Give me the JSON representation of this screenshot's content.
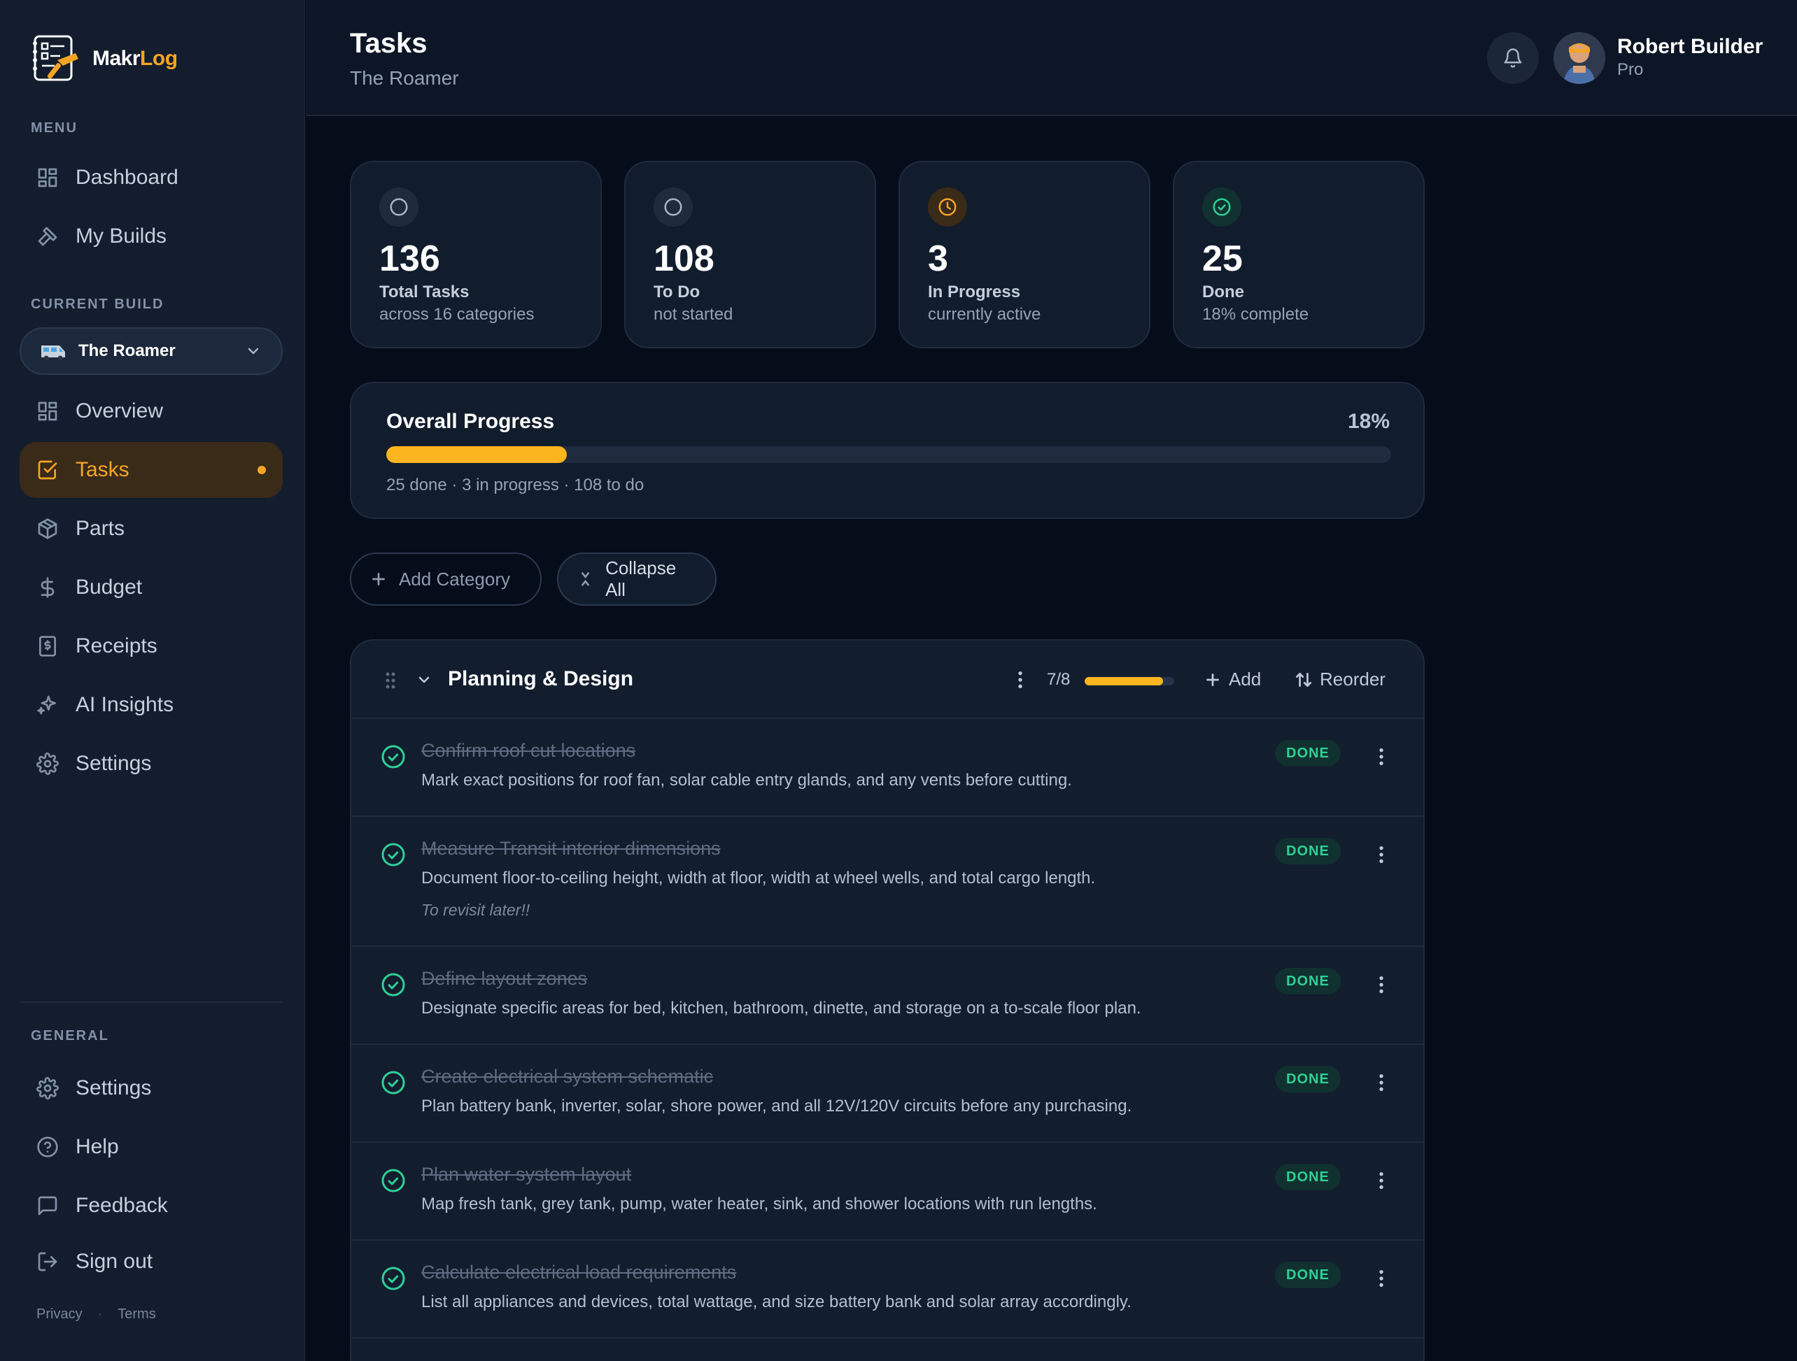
{
  "brand": {
    "name_part1": "Makr",
    "name_part2": "Log"
  },
  "sidebar": {
    "menu_label": "MENU",
    "menu": [
      {
        "label": "Dashboard",
        "icon": "dashboard-icon"
      },
      {
        "label": "My Builds",
        "icon": "hammer-icon"
      }
    ],
    "current_build_label": "CURRENT BUILD",
    "current_build": "The Roamer",
    "build_nav": [
      {
        "label": "Overview",
        "icon": "grid-icon"
      },
      {
        "label": "Tasks",
        "icon": "checkbox-icon",
        "active": true
      },
      {
        "label": "Parts",
        "icon": "box-icon"
      },
      {
        "label": "Budget",
        "icon": "dollar-icon"
      },
      {
        "label": "Receipts",
        "icon": "receipt-icon"
      },
      {
        "label": "AI Insights",
        "icon": "sparkle-icon"
      },
      {
        "label": "Settings",
        "icon": "gear-icon"
      }
    ],
    "general_label": "GENERAL",
    "general": [
      {
        "label": "Settings",
        "icon": "gear-icon"
      },
      {
        "label": "Help",
        "icon": "help-icon"
      },
      {
        "label": "Feedback",
        "icon": "message-icon"
      },
      {
        "label": "Sign out",
        "icon": "sign-out-icon"
      }
    ],
    "footer": {
      "privacy": "Privacy",
      "terms": "Terms",
      "separator": "·"
    }
  },
  "header": {
    "title": "Tasks",
    "subtitle": "The Roamer",
    "user_name": "Robert Builder",
    "user_plan": "Pro"
  },
  "stats": [
    {
      "value": "136",
      "label": "Total Tasks",
      "sub": "across 16 categories",
      "icon": "circle-icon",
      "color": "#aab4c3"
    },
    {
      "value": "108",
      "label": "To Do",
      "sub": "not started",
      "icon": "circle-icon",
      "color": "#aab4c3"
    },
    {
      "value": "3",
      "label": "In Progress",
      "sub": "currently active",
      "icon": "clock-icon",
      "color": "#f5a524"
    },
    {
      "value": "25",
      "label": "Done",
      "sub": "18% complete",
      "icon": "check-circle-icon",
      "color": "#2fcf96"
    }
  ],
  "progress": {
    "title": "Overall Progress",
    "percent_label": "18%",
    "percent": 0.18,
    "summary": "25 done · 3 in progress · 108 to do"
  },
  "actions": {
    "add_category": "Add Category",
    "collapse_all": "Collapse All"
  },
  "category": {
    "name": "Planning & Design",
    "count": "7/8",
    "fraction": 0.875,
    "add_label": "Add",
    "reorder_label": "Reorder",
    "tasks": [
      {
        "title": "Confirm roof cut locations",
        "desc": "Mark exact positions for roof fan, solar cable entry glands, and any vents before cutting.",
        "status": "DONE",
        "note": ""
      },
      {
        "title": "Measure Transit interior dimensions",
        "desc": "Document floor-to-ceiling height, width at floor, width at wheel wells, and total cargo length.",
        "status": "DONE",
        "note": "To revisit later!!"
      },
      {
        "title": "Define layout zones",
        "desc": "Designate specific areas for bed, kitchen, bathroom, dinette, and storage on a to-scale floor plan.",
        "status": "DONE",
        "note": ""
      },
      {
        "title": "Create electrical system schematic",
        "desc": "Plan battery bank, inverter, solar, shore power, and all 12V/120V circuits before any purchasing.",
        "status": "DONE",
        "note": ""
      },
      {
        "title": "Plan water system layout",
        "desc": "Map fresh tank, grey tank, pump, water heater, sink, and shower locations with run lengths.",
        "status": "DONE",
        "note": ""
      },
      {
        "title": "Calculate electrical load requirements",
        "desc": "List all appliances and devices, total wattage, and size battery bank and solar array accordingly.",
        "status": "DONE",
        "note": ""
      }
    ]
  }
}
